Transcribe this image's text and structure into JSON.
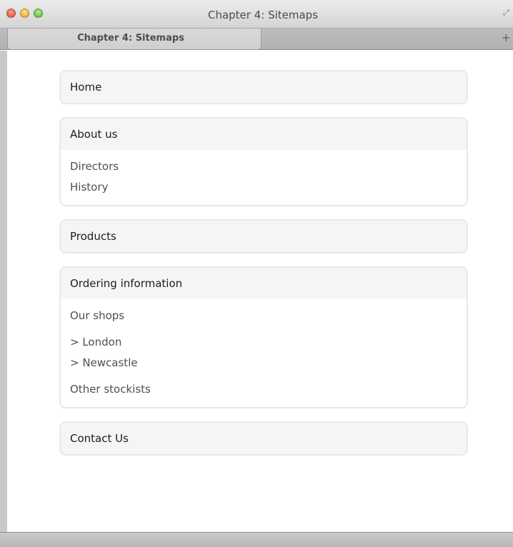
{
  "window": {
    "title": "Chapter 4: Sitemaps",
    "tab_title": "Chapter 4: Sitemaps",
    "new_tab_glyph": "+",
    "fullscreen_glyph": "⤢"
  },
  "sitemap": {
    "home": "Home",
    "about": {
      "label": "About us",
      "children": [
        "Directors",
        "History"
      ]
    },
    "products": "Products",
    "ordering": {
      "label": "Ordering information",
      "our_shops": "Our shops",
      "shops": [
        "> London",
        "> Newcastle"
      ],
      "other": "Other stockists"
    },
    "contact": "Contact Us"
  },
  "colors": {
    "box_border": "#e5eaea",
    "box_header_bg": "#f4f5f5",
    "heading_text": "#1c1c1c",
    "link_text": "#4f4f4f"
  }
}
